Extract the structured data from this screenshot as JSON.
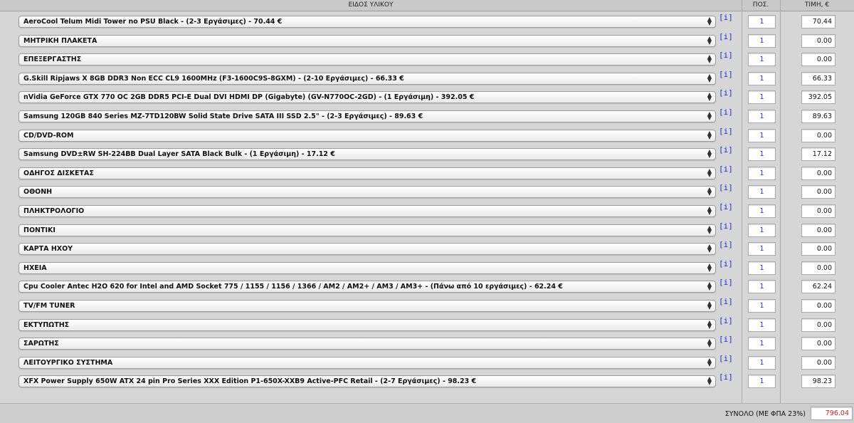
{
  "header": {
    "type_label": "ΕΙΔΟΣ ΥΛΙΚΟΥ",
    "qty_label": "ΠΟΣ.",
    "price_label": "ΤΙΜΗ, €"
  },
  "info_label": "[i]",
  "rows": [
    {
      "selected": "AeroCool Telum Midi Tower no PSU Black - (2-3 Εργάσιμες) - 70.44 €",
      "qty": "1",
      "price": "70.44"
    },
    {
      "selected": "ΜΗΤΡΙΚΗ ΠΛΑΚΕΤΑ",
      "qty": "1",
      "price": "0.00"
    },
    {
      "selected": "ΕΠΕΞΕΡΓΑΣΤΗΣ",
      "qty": "1",
      "price": "0.00"
    },
    {
      "selected": "G.Skill Ripjaws X 8GB DDR3 Non ECC CL9 1600MHz (F3-1600C9S-8GXM) - (2-10 Εργάσιμες) - 66.33 €",
      "qty": "1",
      "price": "66.33"
    },
    {
      "selected": "nVidia GeForce GTX 770 OC 2GB DDR5 PCI-E Dual DVI HDMI DP (Gigabyte) (GV-N770OC-2GD) - (1 Εργάσιμη) - 392.05 €",
      "qty": "1",
      "price": "392.05"
    },
    {
      "selected": "Samsung 120GB 840 Series MZ-7TD120BW Solid State Drive SATA III SSD 2.5\" - (2-3 Εργάσιμες) - 89.63 €",
      "qty": "1",
      "price": "89.63"
    },
    {
      "selected": "CD/DVD-ROM",
      "qty": "1",
      "price": "0.00"
    },
    {
      "selected": "Samsung DVD±RW SH-224BB Dual Layer SATA Black Bulk - (1 Εργάσιμη) - 17.12 €",
      "qty": "1",
      "price": "17.12"
    },
    {
      "selected": "ΟΔΗΓΟΣ ΔΙΣΚΕΤΑΣ",
      "qty": "1",
      "price": "0.00"
    },
    {
      "selected": "ΟΘΟΝΗ",
      "qty": "1",
      "price": "0.00"
    },
    {
      "selected": "ΠΛΗΚΤΡΟΛΟΓΙΟ",
      "qty": "1",
      "price": "0.00"
    },
    {
      "selected": "ΠΟΝΤΙΚΙ",
      "qty": "1",
      "price": "0.00"
    },
    {
      "selected": "ΚΑΡΤΑ ΗΧΟΥ",
      "qty": "1",
      "price": "0.00"
    },
    {
      "selected": "ΗΧΕΙΑ",
      "qty": "1",
      "price": "0.00"
    },
    {
      "selected": "Cpu Cooler Antec H2O 620 for Intel and AMD Socket 775 / 1155 / 1156 / 1366 / AM2 / AM2+ / AM3 / AM3+ - (Πάνω από 10 εργάσιμες) - 62.24 €",
      "qty": "1",
      "price": "62.24"
    },
    {
      "selected": "TV/FM TUNER",
      "qty": "1",
      "price": "0.00"
    },
    {
      "selected": "ΕΚΤΥΠΩΤΗΣ",
      "qty": "1",
      "price": "0.00"
    },
    {
      "selected": "ΣΑΡΩΤΗΣ",
      "qty": "1",
      "price": "0.00"
    },
    {
      "selected": "ΛΕΙΤΟΥΡΓΙΚΟ ΣΥΣΤΗΜΑ",
      "qty": "1",
      "price": "0.00"
    },
    {
      "selected": "XFX Power Supply 650W ATX 24 pin Pro Series XXX Edition P1-650X-XXB9 Active-PFC Retail - (2-7 Εργάσιμες) - 98.23 €",
      "qty": "1",
      "price": "98.23"
    }
  ],
  "footer": {
    "total_label": "ΣΥΝΟΛΟ (ΜΕ ΦΠΑ 23%)",
    "total_value": "796.04"
  },
  "colors": {
    "info_link": "#1a2fd6",
    "qty_text": "#1a2fd6",
    "total_value": "#d21a1a",
    "background": "#d6d6d6"
  }
}
